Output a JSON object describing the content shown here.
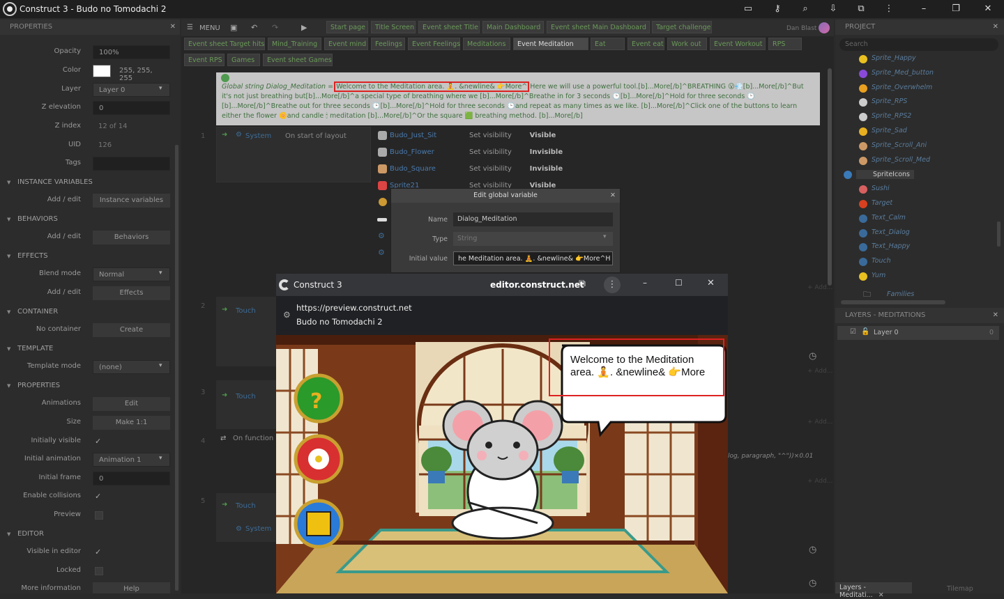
{
  "window": {
    "title": "Construct 3 - Budo no Tomodachi 2"
  },
  "left_panel": {
    "header": "PROPERTIES",
    "opacity_label": "Opacity",
    "opacity": "100%",
    "color_label": "Color",
    "color_value": "255, 255, 255",
    "layer_label": "Layer",
    "layer": "Layer 0",
    "zelev_label": "Z elevation",
    "zelev": "0",
    "zindex_label": "Z index",
    "zindex": "12 of 14",
    "uid_label": "UID",
    "uid": "126",
    "tags_label": "Tags",
    "sec_instance": "INSTANCE VARIABLES",
    "add_edit": "Add / edit",
    "instance_btn": "Instance variables",
    "sec_behaviors": "BEHAVIORS",
    "behaviors_btn": "Behaviors",
    "sec_effects": "EFFECTS",
    "blend_label": "Blend mode",
    "blend": "Normal",
    "effects_btn": "Effects",
    "sec_container": "CONTAINER",
    "no_container": "No container",
    "create_btn": "Create",
    "sec_template": "TEMPLATE",
    "template_mode_label": "Template mode",
    "template_mode": "(none)",
    "sec_properties": "PROPERTIES",
    "animations_label": "Animations",
    "edit_btn": "Edit",
    "size_label": "Size",
    "size_btn": "Make 1:1",
    "init_visible_label": "Initially visible",
    "init_anim_label": "Initial animation",
    "init_anim": "Animation 1",
    "init_frame_label": "Initial frame",
    "init_frame": "0",
    "collisions_label": "Enable collisions",
    "preview_label": "Preview",
    "sec_editor": "EDITOR",
    "visible_editor_label": "Visible in editor",
    "locked_label": "Locked",
    "more_info_label": "More information",
    "help_btn": "Help"
  },
  "toolbar": {
    "menu": "MENU",
    "user": "Dan Blast"
  },
  "tabs_row1": [
    "Start page",
    "Title Screen",
    "Event sheet Title",
    "Main Dashboard",
    "Event sheet Main Dashboard",
    "Target challenge"
  ],
  "tabs_row2": [
    "Event sheet Target hits",
    "Mind_Training",
    "Event mind",
    "Feelings",
    "Event Feelings",
    "Meditations",
    "Event Meditation",
    "Eat",
    "Event eat",
    "Work out",
    "Event Workout",
    "RPS"
  ],
  "tabs_row3": [
    "Event RPS",
    "Games",
    "Event sheet Games"
  ],
  "comment": {
    "prefix": "Global string Dialog_Meditation = ",
    "highlight": "Welcome to the Meditation area. 🧘. &newline& 👉More^",
    "rest": " Here we will use a powerful tool.[b]...More[/b]^BREATHING 😮💨[b]...More[/b]^But it's not just breathing but[b]...More[/b]^a special type of breathing where we [b]...More[/b]^Breathe in for 3 seconds 🕒[b]...More[/b]^Hold for three seconds 🕒[b]...More[/b]^Breathe out for three seconds 🕒[b]...More[/b]^Hold for three seconds 🕒and repeat as many times as we like. [b]...More[/b]^Click one of the buttons to learn either the flower 🌼and candle 🕯 meditation [b]...More[/b]^Or the square 🟩 breathing method. [b]...More[/b]"
  },
  "events": {
    "system": "System",
    "on_start": "On start of layout",
    "actions": [
      {
        "obj": "Budo_Just_Sit",
        "act": "Set visibility",
        "val": "Visible"
      },
      {
        "obj": "Budo_Flower",
        "act": "Set visibility",
        "val": "Invisible"
      },
      {
        "obj": "Budo_Square",
        "act": "Set visibility",
        "val": "Invisible"
      },
      {
        "obj": "Sprite21",
        "act": "Set visibility",
        "val": "Visible"
      }
    ],
    "touch": "Touch",
    "on_function": "On function",
    "expr": "log, paragraph, \"^\"))×0.01",
    "add_action": "+ Add..."
  },
  "dialog": {
    "title": "Edit global variable",
    "name_label": "Name",
    "name": "Dialog_Meditation",
    "type_label": "Type",
    "type": "String",
    "init_label": "Initial value",
    "init": "he Meditation area. 🧘. &newline& 👉More^H"
  },
  "browser": {
    "app": "Construct 3",
    "domain": "editor.construct.net",
    "url": "https://preview.construct.net",
    "page_title": "Budo no Tomodachi 2"
  },
  "game": {
    "bubble": "Welcome to the Meditation area. 🧘. &newline& 👉More"
  },
  "project": {
    "header": "PROJECT",
    "search_placeholder": "Search",
    "items": [
      "Sprite_Happy",
      "Sprite_Med_button",
      "Sprite_Overwhelm",
      "Sprite_RPS",
      "Sprite_RPS2",
      "Sprite_Sad",
      "Sprite_Scroll_Ani",
      "Sprite_Scroll_Med",
      "SpriteIcons",
      "Sushi",
      "Target",
      "Text_Calm",
      "Text_Dialog",
      "Text_Happy",
      "Touch",
      "Yum"
    ],
    "families": "Families"
  },
  "layers": {
    "header": "LAYERS - MEDITATIONS",
    "layer": "Layer 0",
    "count": "0",
    "tab1": "Layers - Meditati...",
    "tab2": "Tilemap"
  }
}
